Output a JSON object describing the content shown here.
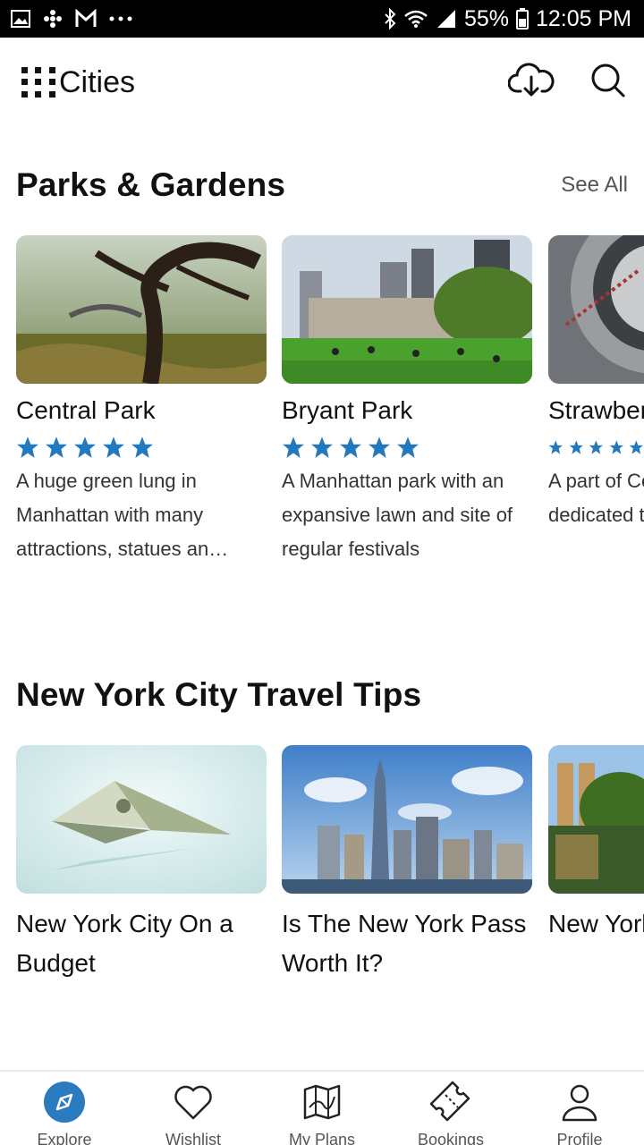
{
  "status_bar": {
    "battery": "55%",
    "time": "12:05 PM",
    "left_icons": [
      "gallery-icon",
      "pinwheel-icon",
      "gmail-icon",
      "more-dots-icon"
    ],
    "right_icons": [
      "bluetooth-icon",
      "wifi-icon",
      "signal-icon",
      "battery-icon"
    ]
  },
  "app_bar": {
    "title": "Cities",
    "actions": [
      "download-cloud-icon",
      "search-icon"
    ]
  },
  "parks": {
    "title": "Parks & Gardens",
    "see_all": "See All",
    "rating": 5,
    "cards": [
      {
        "title": "Central Park",
        "rating": 5,
        "description": "A huge green lung in Manhattan with many attractions, statues an…"
      },
      {
        "title": "Bryant Park",
        "rating": 5,
        "description": "A Manhattan park with an expansive lawn and site of regular festivals"
      },
      {
        "title": "Strawberry Fields",
        "rating": 5,
        "description": "A part of Central Park dedicated to John Lennon"
      }
    ]
  },
  "tips": {
    "title": "New York City Travel Tips",
    "cards": [
      {
        "title": "New York City On a Budget"
      },
      {
        "title": "Is The New York Pass Worth It?"
      },
      {
        "title": "New York at a Glance"
      }
    ]
  },
  "bottom_nav": {
    "items": [
      {
        "label": "Explore",
        "icon": "compass-icon",
        "active": true
      },
      {
        "label": "Wishlist",
        "icon": "heart-icon",
        "active": false
      },
      {
        "label": "My Plans",
        "icon": "map-icon",
        "active": false
      },
      {
        "label": "Bookings",
        "icon": "ticket-icon",
        "active": false
      },
      {
        "label": "Profile",
        "icon": "person-icon",
        "active": false
      }
    ]
  },
  "colors": {
    "accent": "#2b7bbf",
    "star": "#2479bd",
    "status_bar": "#000000"
  }
}
